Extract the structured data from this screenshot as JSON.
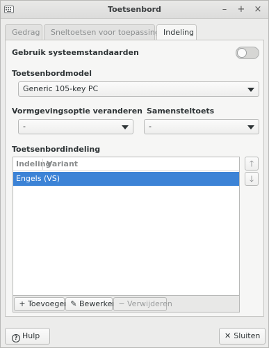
{
  "window": {
    "title": "Toetsenbord",
    "icon": "keyboard-icon",
    "controls": {
      "minimize": "–",
      "maximize": "+",
      "close": "×"
    }
  },
  "tabs": [
    {
      "label": "Gedrag",
      "active": false
    },
    {
      "label": "Sneltoetsen voor toepassingen",
      "active": false
    },
    {
      "label": "Indeling",
      "active": true
    }
  ],
  "layout_tab": {
    "use_system_defaults": {
      "label": "Gebruik systeemstandaarden",
      "enabled": false
    },
    "keyboard_model": {
      "label": "Toetsenbordmodel",
      "value": "Generic 105-key PC"
    },
    "layout_option": {
      "label": "Vormgevingsoptie veranderen",
      "value": "-"
    },
    "compose_key": {
      "label": "Samensteltoets",
      "value": "-"
    },
    "keyboard_layout": {
      "label": "Toetsenbordindeling",
      "columns": [
        "Indeling",
        "Variant"
      ],
      "rows": [
        {
          "layout": "Engels (VS)",
          "variant": "",
          "selected": true
        }
      ]
    },
    "move_up_icon": "arrow-up-icon",
    "move_down_icon": "arrow-down-icon",
    "toolbar": {
      "add": "Toevoegen",
      "edit": "Bewerken",
      "remove": "Verwijderen"
    }
  },
  "footer": {
    "help": "Hulp",
    "close": "Sluiten"
  },
  "colors": {
    "selection": "#3c83d6",
    "window_bg": "#ececeb"
  }
}
